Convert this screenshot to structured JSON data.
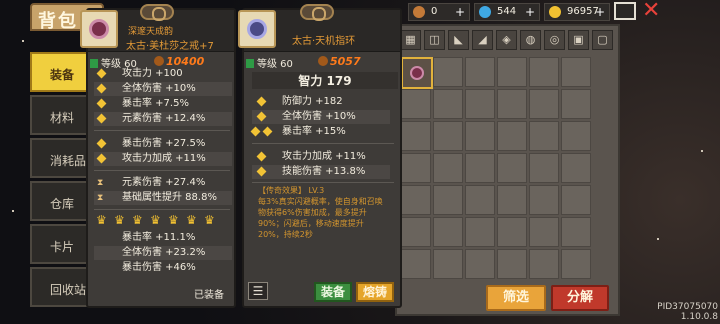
{
  "header": {
    "title": "背包"
  },
  "currencies": [
    {
      "icon": "wood-icon",
      "value": "0",
      "color": "#c47a38"
    },
    {
      "icon": "diamond-icon",
      "value": "544",
      "color": "#3fa9e4"
    },
    {
      "icon": "coin-icon",
      "value": "96957",
      "color": "#f1c131"
    }
  ],
  "plus": "+",
  "left_tabs": [
    "装备",
    "材料",
    "消耗品",
    "仓库",
    "卡片",
    "回收站"
  ],
  "inventory_tabs": [
    "▦",
    "◫",
    "◣",
    "◢",
    "◈",
    "◍",
    "◎",
    "▣",
    "▢"
  ],
  "buttons": {
    "filter": "筛选",
    "decompose": "分解"
  },
  "version": "PID37075070 1.10.0.8",
  "card1": {
    "subtitle": "深邃天成韵",
    "name": "太古·美杜莎之戒+7",
    "level_label": "等级 60",
    "score": "10400",
    "stats_a": [
      "攻击力 +100",
      "全体伤害 +10%",
      "暴击率 +7.5%",
      "元素伤害 +12.4%"
    ],
    "stats_b": [
      "暴击伤害 +27.5%",
      "攻击力加成 +11%"
    ],
    "stats_c": [
      "元素伤害 +27.4%",
      "基础属性提升 88.8%"
    ],
    "stats_d": [
      "暴击率 +11.1%",
      "全体伤害 +23.2%",
      "暴击伤害 +46%"
    ],
    "footer": "已装备"
  },
  "card2": {
    "name": "太古·天机指环",
    "level_label": "等级 60",
    "score": "5057",
    "main_stat": "智力 179",
    "stats_a": [
      "防御力 +182",
      "全体伤害 +10%",
      "暴击率 +15%"
    ],
    "stats_b": [
      "攻击力加成 +11%",
      "技能伤害 +13.8%"
    ],
    "effect_title": "【传奇效果】 LV.3",
    "effect_desc": "每3%真实闪避概率，使自身和召唤物获得6%伤害加成，最多提升90%；闪避后，移动速度提升20%，持续2秒",
    "equip_label": "装备",
    "forge_label": "熔铸"
  }
}
